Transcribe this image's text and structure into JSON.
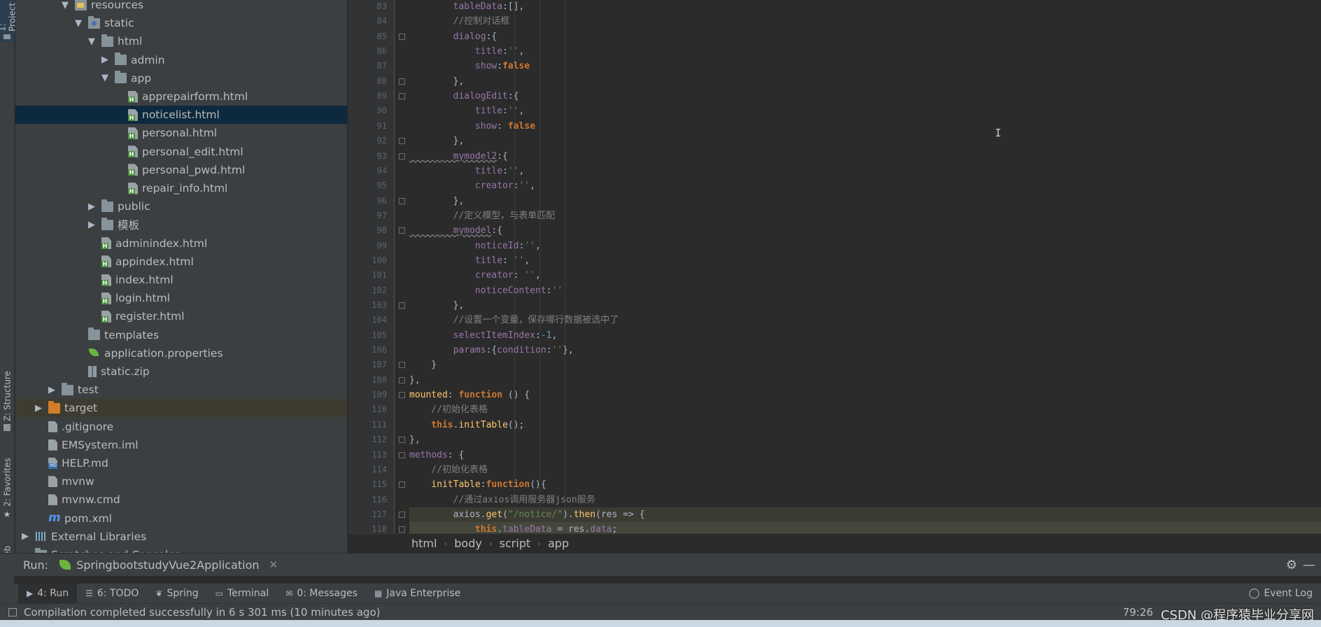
{
  "left_strip": {
    "tabs": [
      {
        "label": "1: Project"
      },
      {
        "label": "Z: Structure"
      },
      {
        "label": "2: Favorites"
      },
      {
        "label": "Web"
      }
    ]
  },
  "project_tree": {
    "rows": [
      {
        "label": "resources",
        "indent": 4,
        "arrow": "▼",
        "icon": "folder-res"
      },
      {
        "label": "static",
        "indent": 5,
        "arrow": "▼",
        "icon": "folder-web"
      },
      {
        "label": "html",
        "indent": 6,
        "arrow": "▼",
        "icon": "folder"
      },
      {
        "label": "admin",
        "indent": 7,
        "arrow": "▶",
        "icon": "folder"
      },
      {
        "label": "app",
        "indent": 7,
        "arrow": "▼",
        "icon": "folder"
      },
      {
        "label": "apprepairform.html",
        "indent": 8,
        "arrow": "",
        "icon": "html"
      },
      {
        "label": "noticelist.html",
        "indent": 8,
        "arrow": "",
        "icon": "html",
        "selected": true
      },
      {
        "label": "personal.html",
        "indent": 8,
        "arrow": "",
        "icon": "html"
      },
      {
        "label": "personal_edit.html",
        "indent": 8,
        "arrow": "",
        "icon": "html"
      },
      {
        "label": "personal_pwd.html",
        "indent": 8,
        "arrow": "",
        "icon": "html"
      },
      {
        "label": "repair_info.html",
        "indent": 8,
        "arrow": "",
        "icon": "html"
      },
      {
        "label": "public",
        "indent": 6,
        "arrow": "▶",
        "icon": "folder"
      },
      {
        "label": "模板",
        "indent": 6,
        "arrow": "▶",
        "icon": "folder"
      },
      {
        "label": "adminindex.html",
        "indent": 6,
        "arrow": "",
        "icon": "html"
      },
      {
        "label": "appindex.html",
        "indent": 6,
        "arrow": "",
        "icon": "html"
      },
      {
        "label": "index.html",
        "indent": 6,
        "arrow": "",
        "icon": "html"
      },
      {
        "label": "login.html",
        "indent": 6,
        "arrow": "",
        "icon": "html"
      },
      {
        "label": "register.html",
        "indent": 6,
        "arrow": "",
        "icon": "html"
      },
      {
        "label": "templates",
        "indent": 5,
        "arrow": "",
        "icon": "folder"
      },
      {
        "label": "application.properties",
        "indent": 5,
        "arrow": "",
        "icon": "leaf"
      },
      {
        "label": "static.zip",
        "indent": 5,
        "arrow": "",
        "icon": "zip"
      },
      {
        "label": "test",
        "indent": 3,
        "arrow": "▶",
        "icon": "folder"
      },
      {
        "label": "target",
        "indent": 2,
        "arrow": "▶",
        "icon": "folder-orange",
        "excluded": true
      },
      {
        "label": ".gitignore",
        "indent": 2,
        "arrow": "",
        "icon": "file"
      },
      {
        "label": "EMSystem.iml",
        "indent": 2,
        "arrow": "",
        "icon": "file"
      },
      {
        "label": "HELP.md",
        "indent": 2,
        "arrow": "",
        "icon": "md"
      },
      {
        "label": "mvnw",
        "indent": 2,
        "arrow": "",
        "icon": "file"
      },
      {
        "label": "mvnw.cmd",
        "indent": 2,
        "arrow": "",
        "icon": "file"
      },
      {
        "label": "pom.xml",
        "indent": 2,
        "arrow": "",
        "icon": "maven"
      },
      {
        "label": "External Libraries",
        "indent": 1,
        "arrow": "▶",
        "icon": "libs"
      },
      {
        "label": "Scratches and Consoles",
        "indent": 1,
        "arrow": "",
        "icon": "folder"
      }
    ]
  },
  "editor": {
    "lines": [
      {
        "n": "83",
        "code": [
          [
            "prop",
            "        tableData"
          ],
          [
            "",
            ":[],"
          ]
        ]
      },
      {
        "n": "84",
        "code": [
          [
            "cm",
            "        //控制对话框"
          ]
        ]
      },
      {
        "n": "85",
        "code": [
          [
            "prop",
            "        dialog"
          ],
          [
            "",
            ":{"
          ]
        ],
        "fold": true
      },
      {
        "n": "86",
        "code": [
          [
            "prop",
            "            title"
          ],
          [
            "",
            ":"
          ],
          [
            "str",
            "''"
          ],
          [
            "",
            ","
          ]
        ]
      },
      {
        "n": "87",
        "code": [
          [
            "prop",
            "            show"
          ],
          [
            "",
            ":"
          ],
          [
            "kw",
            "false"
          ]
        ]
      },
      {
        "n": "88",
        "code": [
          [
            "",
            "        },"
          ]
        ],
        "fold": true
      },
      {
        "n": "89",
        "code": [
          [
            "prop",
            "        dialogEdit"
          ],
          [
            "",
            ":{"
          ]
        ],
        "fold": true
      },
      {
        "n": "90",
        "code": [
          [
            "prop",
            "            title"
          ],
          [
            "",
            ":"
          ],
          [
            "str",
            "''"
          ],
          [
            "",
            ","
          ]
        ]
      },
      {
        "n": "91",
        "code": [
          [
            "prop",
            "            show"
          ],
          [
            "",
            ": "
          ],
          [
            "kw",
            "false"
          ]
        ]
      },
      {
        "n": "92",
        "code": [
          [
            "",
            "        },"
          ]
        ],
        "fold": true
      },
      {
        "n": "93",
        "code": [
          [
            "prop und",
            "        mymodel2"
          ],
          [
            "",
            ":{"
          ]
        ],
        "fold": true
      },
      {
        "n": "94",
        "code": [
          [
            "prop",
            "            title"
          ],
          [
            "",
            ":"
          ],
          [
            "str",
            "''"
          ],
          [
            "",
            ","
          ]
        ]
      },
      {
        "n": "95",
        "code": [
          [
            "prop",
            "            creator"
          ],
          [
            "",
            ":"
          ],
          [
            "str",
            "''"
          ],
          [
            "",
            ","
          ]
        ]
      },
      {
        "n": "96",
        "code": [
          [
            "",
            "        },"
          ]
        ],
        "fold": true
      },
      {
        "n": "97",
        "code": [
          [
            "cm",
            "        //定义模型，与表单匹配"
          ]
        ]
      },
      {
        "n": "98",
        "code": [
          [
            "prop und",
            "        mymodel"
          ],
          [
            "",
            ":{"
          ]
        ],
        "fold": true
      },
      {
        "n": "99",
        "code": [
          [
            "prop",
            "            noticeId"
          ],
          [
            "",
            ":"
          ],
          [
            "str",
            "''"
          ],
          [
            "",
            ","
          ]
        ]
      },
      {
        "n": "100",
        "code": [
          [
            "prop",
            "            title"
          ],
          [
            "",
            ": "
          ],
          [
            "str",
            "''"
          ],
          [
            "",
            ","
          ]
        ]
      },
      {
        "n": "101",
        "code": [
          [
            "prop",
            "            creator"
          ],
          [
            "",
            ": "
          ],
          [
            "str",
            "''"
          ],
          [
            "",
            ","
          ]
        ]
      },
      {
        "n": "102",
        "code": [
          [
            "prop",
            "            noticeContent"
          ],
          [
            "",
            ":"
          ],
          [
            "str",
            "''"
          ]
        ]
      },
      {
        "n": "103",
        "code": [
          [
            "",
            "        },"
          ]
        ],
        "fold": true
      },
      {
        "n": "104",
        "code": [
          [
            "cm",
            "        //设置一个变量，保存哪行数据被选中了"
          ]
        ]
      },
      {
        "n": "105",
        "code": [
          [
            "prop",
            "        selectItemIndex"
          ],
          [
            "",
            ":"
          ],
          [
            "num",
            "-1"
          ],
          [
            "",
            ","
          ]
        ]
      },
      {
        "n": "106",
        "code": [
          [
            "prop",
            "        params"
          ],
          [
            "",
            ":{"
          ],
          [
            "prop",
            "condition"
          ],
          [
            "",
            ":"
          ],
          [
            "str",
            "''"
          ],
          [
            "",
            "},"
          ]
        ]
      },
      {
        "n": "107",
        "code": [
          [
            "",
            "    }"
          ]
        ],
        "fold": true
      },
      {
        "n": "108",
        "code": [
          [
            "",
            "},"
          ]
        ],
        "fold": true
      },
      {
        "n": "109",
        "code": [
          [
            "fn",
            "mounted"
          ],
          [
            "",
            ": "
          ],
          [
            "kw",
            "function"
          ],
          [
            "",
            " () {"
          ]
        ],
        "fold": true
      },
      {
        "n": "110",
        "code": [
          [
            "cm",
            "    //初始化表格"
          ]
        ]
      },
      {
        "n": "111",
        "code": [
          [
            "kw",
            "    this"
          ],
          [
            "",
            "."
          ],
          [
            "fn",
            "initTable"
          ],
          [
            "",
            "();"
          ]
        ]
      },
      {
        "n": "112",
        "code": [
          [
            "",
            "},"
          ]
        ],
        "fold": true
      },
      {
        "n": "113",
        "code": [
          [
            "prop",
            "methods"
          ],
          [
            "",
            ": {"
          ]
        ],
        "fold": true
      },
      {
        "n": "114",
        "code": [
          [
            "cm",
            "    //初始化表格"
          ]
        ]
      },
      {
        "n": "115",
        "code": [
          [
            "fn",
            "    initTable"
          ],
          [
            "",
            ":"
          ],
          [
            "kw",
            "function"
          ],
          [
            "",
            "(){"
          ]
        ],
        "fold": true
      },
      {
        "n": "116",
        "code": [
          [
            "cm",
            "        //通过axios调用服务器json服务"
          ]
        ]
      },
      {
        "n": "117",
        "code": [
          [
            "",
            "        axios."
          ],
          [
            "fn",
            "get"
          ],
          [
            "",
            "("
          ],
          [
            "str",
            "\"/notice/\""
          ],
          [
            "",
            ")."
          ],
          [
            "fn",
            "then"
          ],
          [
            "",
            "(res => {"
          ]
        ],
        "fold": true,
        "hl": true
      },
      {
        "n": "118",
        "code": [
          [
            "kw",
            "            this"
          ],
          [
            "",
            "."
          ],
          [
            "prop",
            "tableData"
          ],
          [
            "",
            " = res."
          ],
          [
            "prop",
            "data"
          ],
          [
            "",
            ";"
          ]
        ],
        "fold": true,
        "hl2": true
      }
    ]
  },
  "breadcrumb": [
    "html",
    "body",
    "script",
    "app"
  ],
  "run_bar": {
    "label": "Run:",
    "config": "SpringbootstudyVue2Application"
  },
  "tool_tabs": [
    {
      "label": "4: Run",
      "icon": "run-icon",
      "glyph": "▶",
      "active": true
    },
    {
      "label": "6: TODO",
      "icon": "todo-icon",
      "glyph": "☰"
    },
    {
      "label": "Spring",
      "icon": "spring-icon",
      "glyph": "❦"
    },
    {
      "label": "Terminal",
      "icon": "terminal-icon",
      "glyph": "▭"
    },
    {
      "label": "0: Messages",
      "icon": "messages-icon",
      "glyph": "✉"
    },
    {
      "label": "Java Enterprise",
      "icon": "java-enterprise-icon",
      "glyph": "▦"
    }
  ],
  "event_log": "Event Log",
  "status": {
    "message": "Compilation completed successfully in 6 s 301 ms (10 minutes ago)",
    "caret": "79:26",
    "watermark": "CSDN @程序猿毕业分享网"
  },
  "colors": {
    "accent_selected": "#0d293e",
    "keyword": "#cc7832",
    "string": "#6a8759",
    "property": "#9876aa",
    "comment": "#808080"
  }
}
